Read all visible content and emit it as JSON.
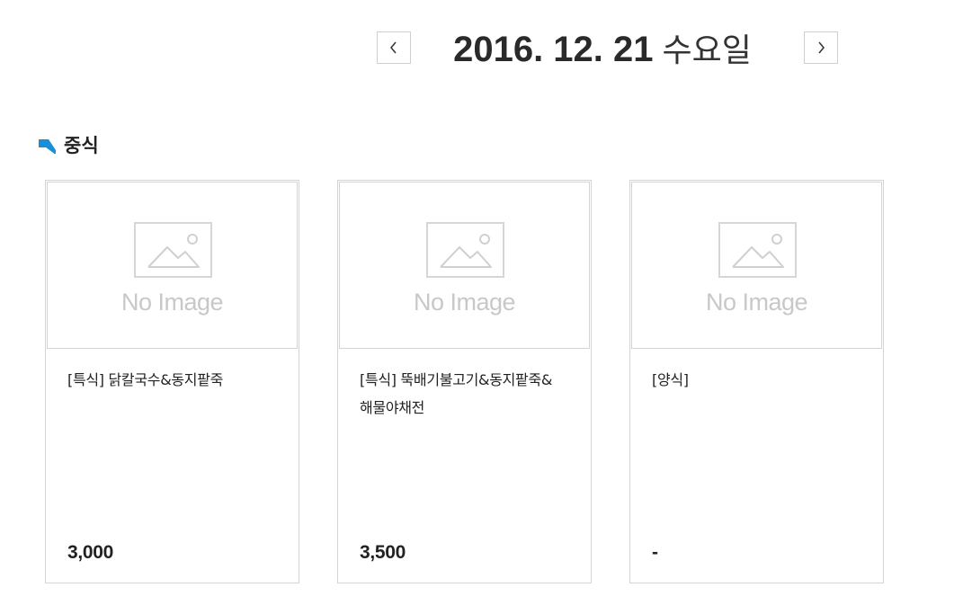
{
  "date_nav": {
    "date": "2016. 12. 21",
    "weekday": "수요일",
    "prev_icon": "chevron-left-icon",
    "next_icon": "chevron-right-icon"
  },
  "section": {
    "title": "중식",
    "marker_icon": "section-marker-icon",
    "marker_color": "#1a8fd8"
  },
  "menu_items": [
    {
      "image_text": "No Image",
      "name": "[특식] 닭칼국수&동지팥죽",
      "price": "3,000"
    },
    {
      "image_text": "No Image",
      "name": "[특식] 뚝배기불고기&동지팥죽&해물야채전",
      "price": "3,500"
    },
    {
      "image_text": "No Image",
      "name": "[양식]",
      "price": "-"
    }
  ]
}
